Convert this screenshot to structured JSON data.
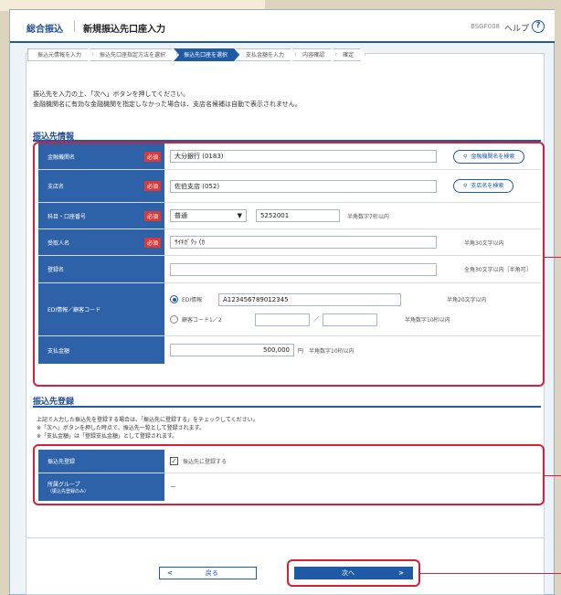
{
  "header": {
    "main": "総合振込",
    "title": "新規振込先口座入力",
    "code": "BSGF008",
    "help": "ヘルプ",
    "help_icon": "?"
  },
  "steps": [
    "振込元情報を入力",
    "振込先口座指定方法を選択",
    "振込先口座を選択",
    "支払金額を入力",
    "内容確認",
    "確定"
  ],
  "intro": [
    "振込先を入力の上、「次へ」ボタンを押してください。",
    "金融機関名に有効な金融機関を指定しなかった場合は、支店名候補は自動で表示されません。"
  ],
  "payee": {
    "title": "振込先情報",
    "required": "必須",
    "bank_label": "金融機関名",
    "bank_value": "大分銀行 (0183)",
    "bank_search": "金融機関名を検索",
    "branch_label": "支店名",
    "branch_value": "佐伯支店 (052)",
    "branch_search": "支店名を検索",
    "account_label": "科目・口座番号",
    "account_type": "普通",
    "account_no": "5252001",
    "account_note": "半角数字7桁以内",
    "recipient_label": "受取人名",
    "recipient_value": "ｻｲｷｶﾞｸｯ (ｶ",
    "recipient_note": "半角30文字以内",
    "alias_label": "登録名",
    "alias_note": "全角30文字以内［半角可］",
    "edi_label": "EDI情報／顧客コード",
    "edi_option": "EDI情報",
    "edi_value": "A123456789012345",
    "edi_note": "半角20文字以内",
    "code_option": "顧客コード1／2",
    "code_sep": "／",
    "code_note": "半角数字10桁以内",
    "amount_label": "支払金額",
    "amount_value": "500,000",
    "amount_unit": "円",
    "amount_note": "半角数字10桁以内"
  },
  "register": {
    "title": "振込先登録",
    "lines": [
      "上記で入力した振込先を登録する場合は、「振込先に登録する」をチェックしてください。",
      "※「次へ」ボタンを押した時点で、振込先一覧として登録されます。",
      "※「支払金額」は「登録支払金額」として登録されます。"
    ],
    "label": "振込先登録",
    "checkbox": "振込先に登録する",
    "group_label": "所属グループ",
    "group_sub": "（振込先登録のみ）",
    "group_value": "－"
  },
  "nav": {
    "back": "戻る",
    "next": "次へ"
  }
}
